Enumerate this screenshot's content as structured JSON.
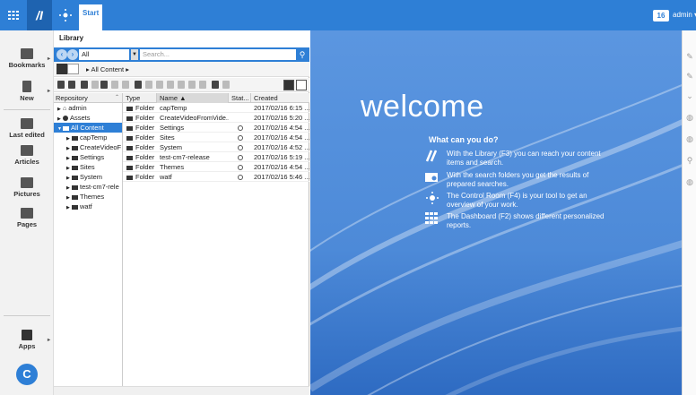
{
  "topbar": {
    "tab_label": "Start",
    "count": "16",
    "user": "admin ▾"
  },
  "leftnav": {
    "items": [
      {
        "label": "Bookmarks",
        "icon": "bookmarks-icon"
      },
      {
        "label": "New",
        "icon": "new-document-icon"
      },
      {
        "label": "Last edited",
        "icon": "last-edited-icon"
      },
      {
        "label": "Articles",
        "icon": "articles-icon"
      },
      {
        "label": "Pictures",
        "icon": "pictures-icon"
      },
      {
        "label": "Pages",
        "icon": "pages-icon"
      },
      {
        "label": "Apps",
        "icon": "apps-icon"
      }
    ]
  },
  "library": {
    "title": "Library",
    "scope": "All",
    "search_placeholder": "Search...",
    "breadcrumb": "All Content",
    "tree": {
      "header": "Repository",
      "rows": [
        {
          "label": "admin",
          "level": 0,
          "selected": false
        },
        {
          "label": "Assets",
          "level": 0,
          "selected": false
        },
        {
          "label": "All Content",
          "level": 0,
          "selected": true
        },
        {
          "label": "capTemp",
          "level": 1,
          "selected": false
        },
        {
          "label": "CreateVideoF",
          "level": 1,
          "selected": false
        },
        {
          "label": "Settings",
          "level": 1,
          "selected": false
        },
        {
          "label": "Sites",
          "level": 1,
          "selected": false
        },
        {
          "label": "System",
          "level": 1,
          "selected": false
        },
        {
          "label": "test-cm7-rele",
          "level": 1,
          "selected": false
        },
        {
          "label": "Themes",
          "level": 1,
          "selected": false
        },
        {
          "label": "watf",
          "level": 1,
          "selected": false
        }
      ]
    },
    "list": {
      "columns": [
        "Type",
        "Name ▲",
        "Stat...",
        "Created"
      ],
      "rows": [
        {
          "type": "Folder",
          "name": "capTemp",
          "status": "",
          "created": "2017/02/16 6:15 ..."
        },
        {
          "type": "Folder",
          "name": "CreateVideoFromVide...",
          "status": "",
          "created": "2017/02/16 5:20 ..."
        },
        {
          "type": "Folder",
          "name": "Settings",
          "status": "globe",
          "created": "2017/02/16 4:54 ..."
        },
        {
          "type": "Folder",
          "name": "Sites",
          "status": "globe",
          "created": "2017/02/16 4:54 ..."
        },
        {
          "type": "Folder",
          "name": "System",
          "status": "globe",
          "created": "2017/02/16 4:52 ..."
        },
        {
          "type": "Folder",
          "name": "test-cm7-release",
          "status": "globe",
          "created": "2017/02/16 5:19 ..."
        },
        {
          "type": "Folder",
          "name": "Themes",
          "status": "globe",
          "created": "2017/02/16 4:54 ..."
        },
        {
          "type": "Folder",
          "name": "watf",
          "status": "globe",
          "created": "2017/02/16 5:46 ..."
        }
      ]
    }
  },
  "welcome": {
    "title": "welcome",
    "subtitle": "What can you do?",
    "items": [
      {
        "icon": "library-icon",
        "text": "With the Library (F3) you can reach your content items and search."
      },
      {
        "icon": "search-folder-icon",
        "text": "With the search folders you get the results of prepared searches."
      },
      {
        "icon": "control-room-icon",
        "text": "The Control Room (F4) is your tool to get an overview of your work."
      },
      {
        "icon": "dashboard-icon",
        "text": "The Dashboard (F2) shows different personalized reports."
      }
    ]
  },
  "colors": {
    "accent": "#2e7fd6",
    "welcome_bg": "#4d8ad8"
  }
}
